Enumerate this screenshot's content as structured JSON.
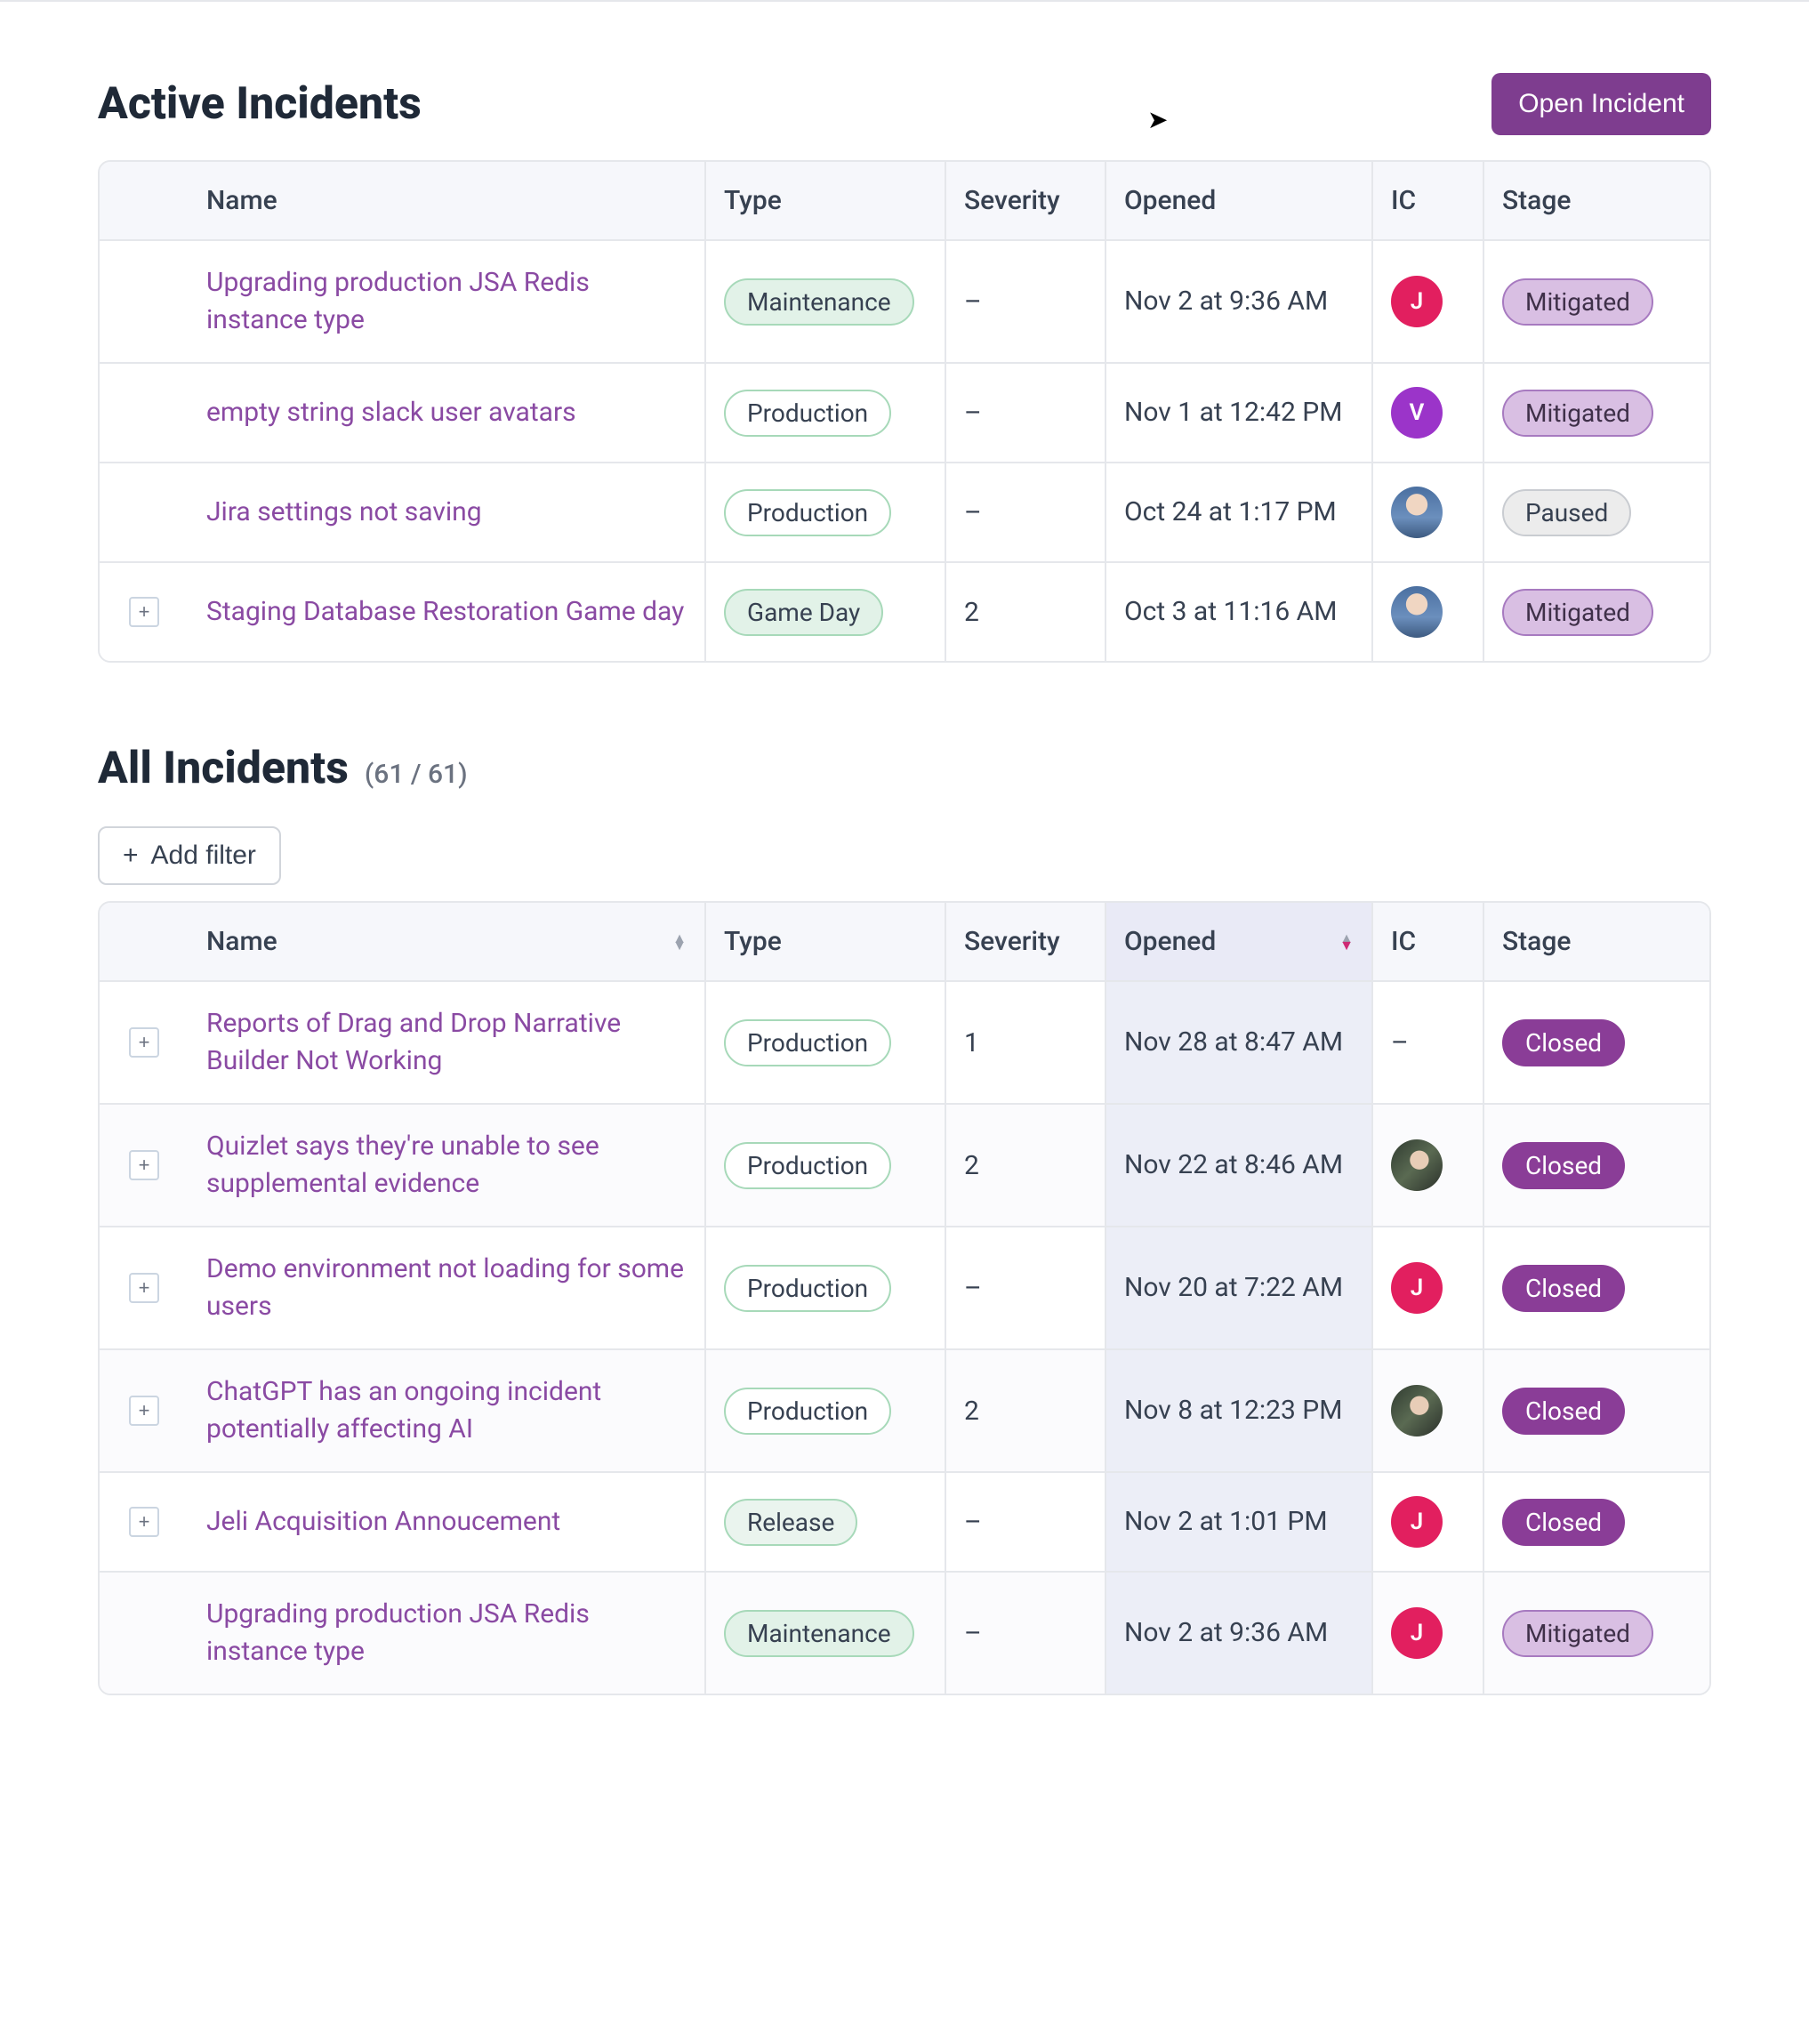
{
  "header": {
    "active_title": "Active Incidents",
    "open_incident_label": "Open Incident",
    "all_title": "All Incidents",
    "all_count_text": "(61 / 61)"
  },
  "columns": {
    "name": "Name",
    "type": "Type",
    "severity": "Severity",
    "opened": "Opened",
    "ic": "IC",
    "stage": "Stage"
  },
  "filter": {
    "add_filter_label": "Add filter"
  },
  "type_labels": {
    "production": "Production",
    "maintenance": "Maintenance",
    "gameday": "Game Day",
    "release": "Release"
  },
  "stage_labels": {
    "mitigated": "Mitigated",
    "paused": "Paused",
    "closed": "Closed"
  },
  "ic_labels": {
    "j": "J",
    "v": "V"
  },
  "active_incidents": [
    {
      "name": "Upgrading production JSA Redis instance type",
      "type": "maintenance",
      "severity": "–",
      "opened": "Nov 2 at 9:36 AM",
      "ic": "j",
      "stage": "mitigated",
      "expandable": false
    },
    {
      "name": "empty string slack user avatars",
      "type": "production",
      "severity": "–",
      "opened": "Nov 1 at 12:42 PM",
      "ic": "v",
      "stage": "mitigated",
      "expandable": false
    },
    {
      "name": "Jira settings not saving",
      "type": "production",
      "severity": "–",
      "opened": "Oct 24 at 1:17 PM",
      "ic": "photo1",
      "stage": "paused",
      "expandable": false
    },
    {
      "name": "Staging Database Restoration Game day",
      "type": "gameday",
      "severity": "2",
      "opened": "Oct 3 at 11:16 AM",
      "ic": "photo1",
      "stage": "mitigated",
      "expandable": true
    }
  ],
  "all_incidents": [
    {
      "name": "Reports of Drag and Drop Narrative Builder Not Working",
      "type": "production",
      "severity": "1",
      "opened": "Nov 28 at 8:47 AM",
      "ic": "none",
      "stage": "closed",
      "expandable": true
    },
    {
      "name": "Quizlet says they're unable to see supplemental evidence",
      "type": "production",
      "severity": "2",
      "opened": "Nov 22 at 8:46 AM",
      "ic": "photo2",
      "stage": "closed",
      "expandable": true
    },
    {
      "name": "Demo environment not loading for some users",
      "type": "production",
      "severity": "–",
      "opened": "Nov 20 at 7:22 AM",
      "ic": "j",
      "stage": "closed",
      "expandable": true
    },
    {
      "name": "ChatGPT has an ongoing incident potentially affecting AI",
      "type": "production",
      "severity": "2",
      "opened": "Nov 8 at 12:23 PM",
      "ic": "photo2",
      "stage": "closed",
      "expandable": true
    },
    {
      "name": "Jeli Acquisition Annoucement",
      "type": "release",
      "severity": "–",
      "opened": "Nov 2 at 1:01 PM",
      "ic": "j",
      "stage": "closed",
      "expandable": true
    },
    {
      "name": "Upgrading production JSA Redis instance type",
      "type": "maintenance",
      "severity": "–",
      "opened": "Nov 2 at 9:36 AM",
      "ic": "j",
      "stage": "mitigated",
      "expandable": false
    }
  ]
}
